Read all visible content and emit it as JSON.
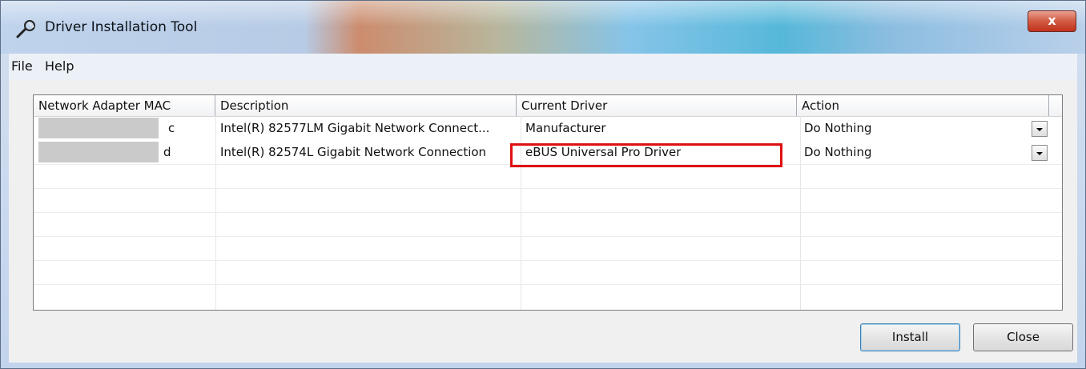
{
  "window": {
    "title": "Driver Installation Tool",
    "close_glyph": "x",
    "icon": "wrench-icon"
  },
  "menu": {
    "items": [
      {
        "label": "File"
      },
      {
        "label": "Help"
      }
    ]
  },
  "table": {
    "columns": [
      {
        "label": "Network Adapter MAC"
      },
      {
        "label": "Description"
      },
      {
        "label": "Current Driver"
      },
      {
        "label": "Action"
      }
    ],
    "rows": [
      {
        "mac_visible_suffix": "c",
        "description": "Intel(R) 82577LM Gigabit Network Connect...",
        "current_driver": "Manufacturer",
        "action": "Do Nothing"
      },
      {
        "mac_visible_suffix": "d",
        "description": "Intel(R) 82574L Gigabit Network Connection",
        "current_driver": "eBUS Universal Pro Driver",
        "action": "Do Nothing"
      }
    ]
  },
  "buttons": {
    "install": "Install",
    "close": "Close"
  },
  "colors": {
    "highlight_border": "#e01010",
    "close_button": "#c0321c"
  }
}
